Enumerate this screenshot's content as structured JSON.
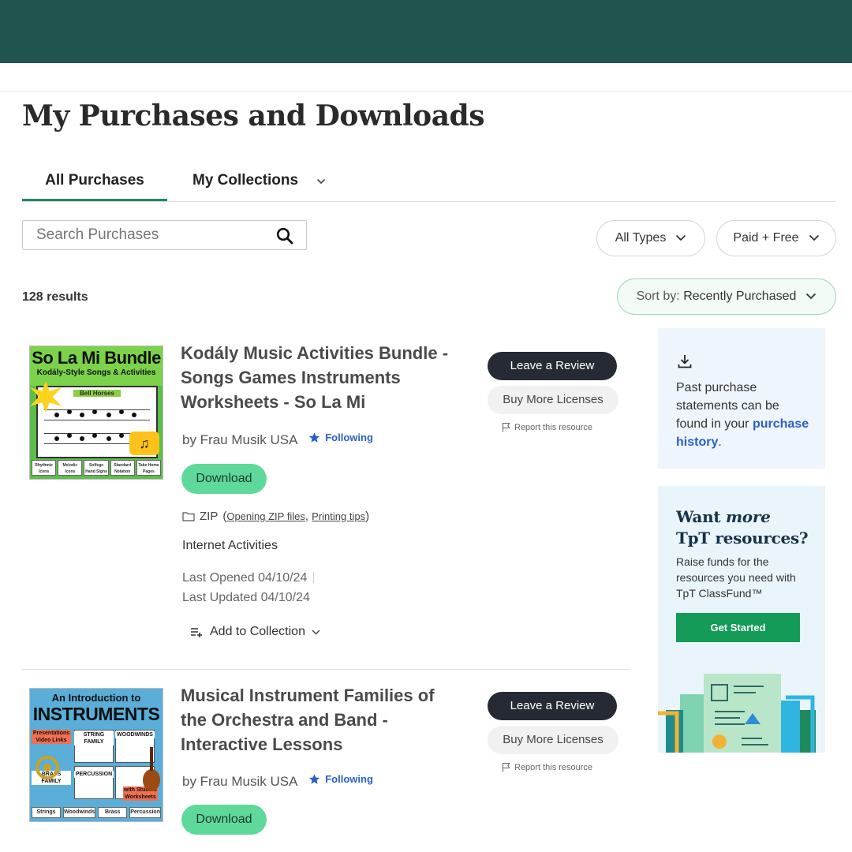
{
  "page": {
    "title": "My Purchases and Downloads",
    "brand_color": "#21544d"
  },
  "tabs": [
    {
      "label": "All Purchases",
      "active": true
    },
    {
      "label": "My Collections",
      "active": false
    }
  ],
  "search": {
    "placeholder": "Search Purchases",
    "value": ""
  },
  "filters": {
    "types": "All Types",
    "price": "Paid + Free",
    "sort_prefix": "Sort by:",
    "sort_value": "Recently Purchased"
  },
  "results_count": "128 results",
  "items": [
    {
      "thumbnail": {
        "title": "So La Mi Bundle",
        "subtitle": "Kodály-Style Songs & Activities",
        "board_label": "Bell Horses",
        "features": [
          "Rhythmic Icons",
          "Melodic Icons",
          "Solfege Hand Signs",
          "Standard Notation",
          "Take Home Pages"
        ]
      },
      "title": "Kodály Music Activities Bundle - Songs Games Instruments Worksheets - So La Mi",
      "author": "by Frau Musik USA",
      "following": "Following",
      "download_label": "Download",
      "file_type": "ZIP",
      "file_link_1": "Opening ZIP files",
      "file_link_2": "Printing tips",
      "resource_type": "Internet Activities",
      "last_opened": "Last Opened 04/10/24",
      "last_updated": "Last Updated 04/10/24",
      "add_collection": "Add to Collection",
      "review_label": "Leave a Review",
      "licenses_label": "Buy More Licenses",
      "report_label": "Report this resource"
    },
    {
      "thumbnail": {
        "title_top": "An Introduction to",
        "title_main": "INSTRUMENTS",
        "labels": [
          "Presentations Video Links",
          "STRING FAMILY",
          "WOODWINDS",
          "BRASS FAMILY",
          "PERCUSSION",
          "with Student Worksheets"
        ],
        "features": [
          "Strings",
          "Woodwinds",
          "Brass",
          "Percussion"
        ]
      },
      "title": "Musical Instrument Families of the Orchestra and Band - Interactive Lessons",
      "author": "by Frau Musik USA",
      "following": "Following",
      "download_label": "Download",
      "review_label": "Leave a Review",
      "licenses_label": "Buy More Licenses",
      "report_label": "Report this resource"
    }
  ],
  "sidebar": {
    "history_text": "Past purchase statements can be found in your",
    "history_link": "purchase history",
    "promo_title_1": "Want",
    "promo_title_em": "more",
    "promo_title_2": "TpT resources?",
    "promo_text": "Raise funds for the resources you need with TpT ClassFund™",
    "promo_button": "Get Started"
  }
}
